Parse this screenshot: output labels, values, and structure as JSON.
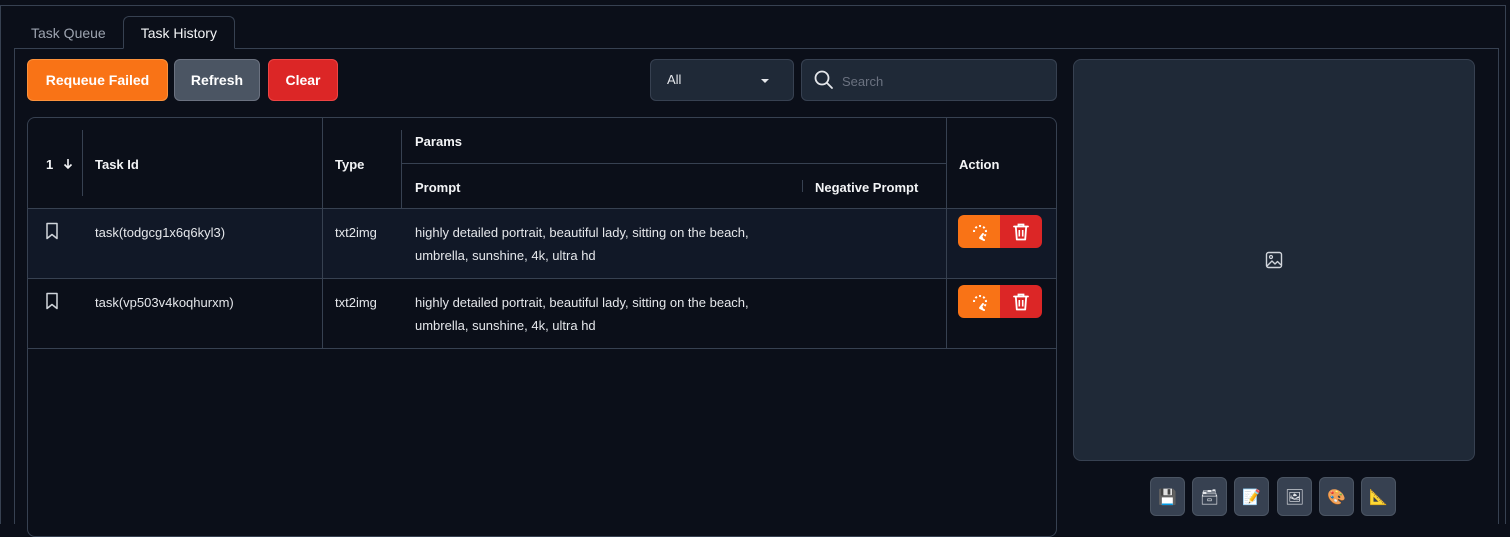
{
  "tabs": [
    {
      "label": "Task Queue",
      "active": false
    },
    {
      "label": "Task History",
      "active": true
    }
  ],
  "toolbar": {
    "requeue_failed_label": "Requeue Failed",
    "refresh_label": "Refresh",
    "clear_label": "Clear"
  },
  "filter": {
    "selected": "All"
  },
  "search": {
    "placeholder": "Search",
    "value": ""
  },
  "table": {
    "columns": {
      "index": "1",
      "task_id": "Task Id",
      "type": "Type",
      "params": "Params",
      "prompt": "Prompt",
      "negative_prompt": "Negative Prompt",
      "action": "Action"
    },
    "rows": [
      {
        "task_id": "task(todgcg1x6q6kyl3)",
        "type": "txt2img",
        "prompt_line1": "highly detailed portrait, beautiful lady, sitting on the beach,",
        "prompt_line2": "umbrella, sunshine, 4k, ultra hd",
        "negative_prompt": ""
      },
      {
        "task_id": "task(vp503v4koqhurxm)",
        "type": "txt2img",
        "prompt_line1": "highly detailed portrait, beautiful lady, sitting on the beach,",
        "prompt_line2": "umbrella, sunshine, 4k, ultra hd",
        "negative_prompt": ""
      }
    ]
  },
  "preview_tools": [
    {
      "icon": "save-icon",
      "glyph": "💾"
    },
    {
      "icon": "zip-icon",
      "glyph": "🗃"
    },
    {
      "icon": "send-to-img2img-icon",
      "glyph": "📝"
    },
    {
      "icon": "send-to-inpaint-icon",
      "glyph": "🖼"
    },
    {
      "icon": "palette-icon",
      "glyph": "🎨"
    },
    {
      "icon": "ruler-icon",
      "glyph": "📐"
    }
  ],
  "colors": {
    "accent_orange": "#f97316",
    "danger_red": "#dc2626",
    "background": "#0b0f19",
    "surface": "#1f2937"
  }
}
